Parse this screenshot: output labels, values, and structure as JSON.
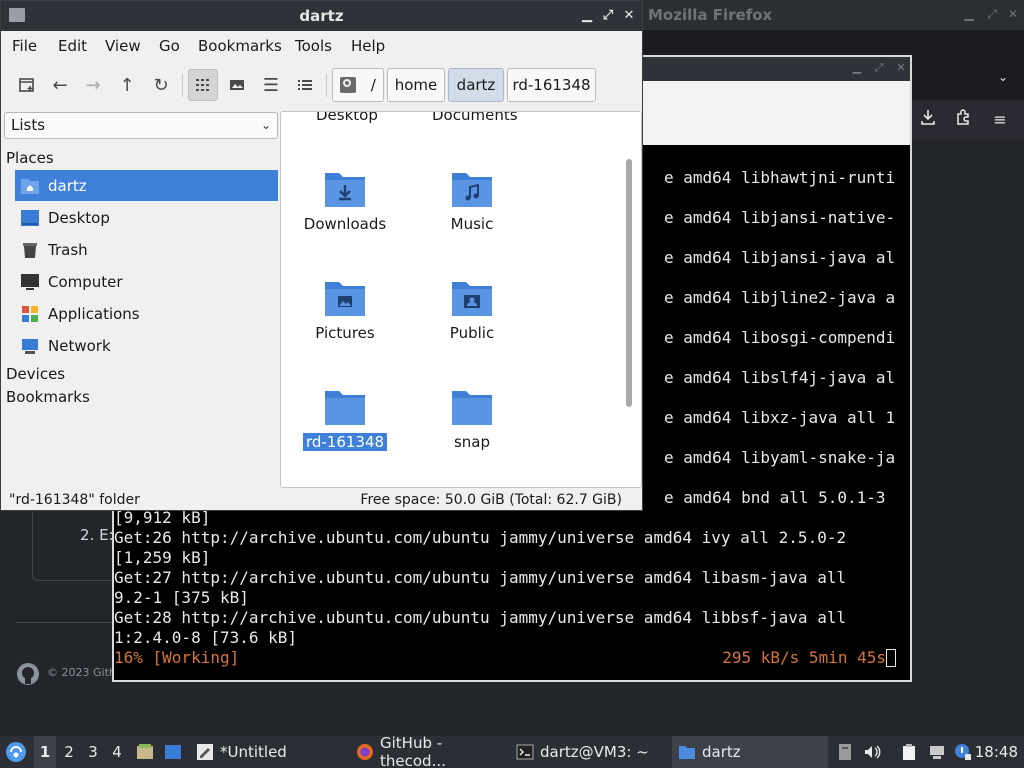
{
  "firefox": {
    "title": "Mozilla Firefox",
    "step_text": "2. E:",
    "footer_text": "© 2023 Gith"
  },
  "terminal": {
    "lines_right": [
      "e amd64 libhawtjni-runti",
      "e amd64 libjansi-native-",
      "e amd64 libjansi-java al",
      "e amd64 libjline2-java a",
      "e amd64 libosgi-compendi",
      "e amd64 libslf4j-java al",
      "e amd64 libxz-java all 1",
      "e amd64 libyaml-snake-ja",
      "e amd64 bnd all 5.0.1-3"
    ],
    "lines_full": [
      "[9,912 kB]",
      "Get:26 http://archive.ubuntu.com/ubuntu jammy/universe amd64 ivy all 2.5.0-2",
      "[1,259 kB]",
      "Get:27 http://archive.ubuntu.com/ubuntu jammy/universe amd64 libasm-java all",
      "9.2-1 [375 kB]",
      "Get:28 http://archive.ubuntu.com/ubuntu jammy/universe amd64 libbsf-java all",
      "1:2.4.0-8 [73.6 kB]"
    ],
    "progress": "16% [Working]",
    "speed": "295 kB/s 5min 45s"
  },
  "file_manager": {
    "title": "dartz",
    "menu": [
      "File",
      "Edit",
      "View",
      "Go",
      "Bookmarks",
      "Tools",
      "Help"
    ],
    "breadcrumbs": [
      "/",
      "home",
      "dartz",
      "rd-161348"
    ],
    "sidebar_mode": "Lists",
    "sections": {
      "places": "Places",
      "devices": "Devices",
      "bookmarks": "Bookmarks"
    },
    "places": [
      {
        "label": "dartz",
        "icon": "home-folder-icon"
      },
      {
        "label": "Desktop",
        "icon": "desktop-icon"
      },
      {
        "label": "Trash",
        "icon": "trash-icon"
      },
      {
        "label": "Computer",
        "icon": "computer-icon"
      },
      {
        "label": "Applications",
        "icon": "applications-icon"
      },
      {
        "label": "Network",
        "icon": "network-icon"
      }
    ],
    "partial_items": [
      "Desktop",
      "Documents"
    ],
    "items": [
      {
        "label": "Downloads",
        "icon": "downloads-folder-icon"
      },
      {
        "label": "Music",
        "icon": "music-folder-icon"
      },
      {
        "label": "Pictures",
        "icon": "pictures-folder-icon"
      },
      {
        "label": "Public",
        "icon": "public-folder-icon"
      },
      {
        "label": "rd-161348",
        "icon": "folder-icon"
      },
      {
        "label": "snap",
        "icon": "folder-icon"
      }
    ],
    "status_left": "\"rd-161348\" folder",
    "status_right": "Free space: 50.0 GiB (Total: 62.7 GiB)",
    "folder_color": "#4a8be0",
    "selection_color": "#3f80d9"
  },
  "taskbar": {
    "workspaces": [
      "1",
      "2",
      "3",
      "4"
    ],
    "tasks": [
      {
        "label": "*Untitled",
        "icon": "text-editor-icon"
      },
      {
        "label": "GitHub - thecod...",
        "icon": "firefox-icon"
      },
      {
        "label": "dartz@VM3: ~",
        "icon": "terminal-icon"
      },
      {
        "label": "dartz",
        "icon": "folder-icon"
      }
    ],
    "clock": "18:48"
  }
}
